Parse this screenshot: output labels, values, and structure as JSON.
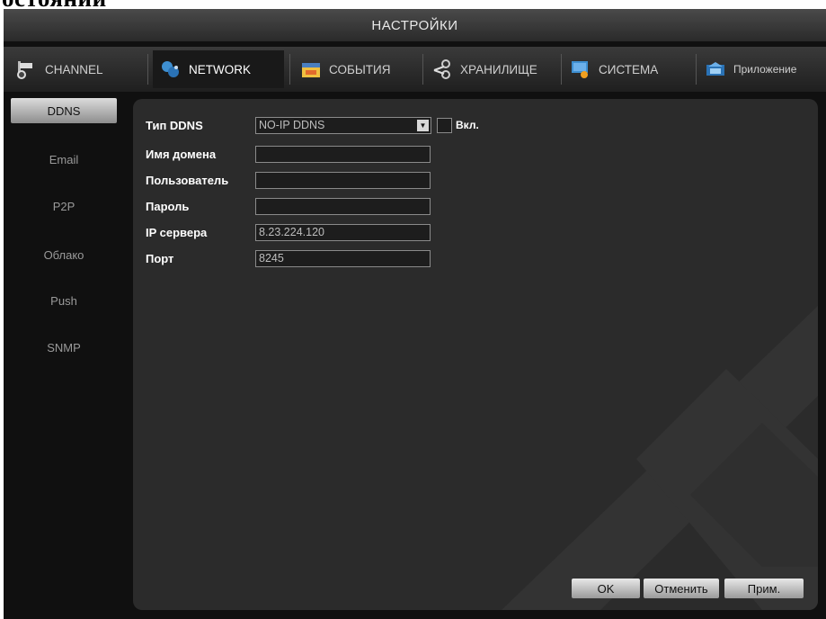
{
  "page_heading_fragment": "остояний",
  "window": {
    "title": "НАСТРОЙКИ"
  },
  "tabs": [
    {
      "label": "CHANNEL",
      "icon": "camera-icon",
      "active": false
    },
    {
      "label": "NETWORK",
      "icon": "network-icon",
      "active": true
    },
    {
      "label": "СОБЫТИЯ",
      "icon": "calendar-events-icon",
      "active": false
    },
    {
      "label": "ХРАНИЛИЩЕ",
      "icon": "storage-icon",
      "active": false
    },
    {
      "label": "СИСТЕМА",
      "icon": "system-icon",
      "active": false
    },
    {
      "label": "Приложение",
      "icon": "apps-icon",
      "active": false
    }
  ],
  "sidebar": {
    "items": [
      {
        "label": "DDNS",
        "active": true
      },
      {
        "label": "Email",
        "active": false
      },
      {
        "label": "P2P",
        "active": false
      },
      {
        "label": "Облако",
        "active": false
      },
      {
        "label": "Push",
        "active": false
      },
      {
        "label": "SNMP",
        "active": false
      }
    ]
  },
  "form": {
    "ddns_type": {
      "label": "Тип DDNS",
      "value": "NO-IP DDNS",
      "enable_label": "Вкл.",
      "enabled": false
    },
    "domain": {
      "label": "Имя домена",
      "value": ""
    },
    "user": {
      "label": "Пользователь",
      "value": ""
    },
    "password": {
      "label": "Пароль",
      "value": ""
    },
    "server_ip": {
      "label": "IP сервера",
      "value": "8.23.224.120"
    },
    "port": {
      "label": "Порт",
      "value": "8245"
    }
  },
  "buttons": {
    "ok": "OK",
    "cancel": "Отменить",
    "apply": "Прим."
  },
  "colors": {
    "background": "#101010",
    "panel": "#2b2b2b",
    "accent_active": "#dcdcdc"
  }
}
